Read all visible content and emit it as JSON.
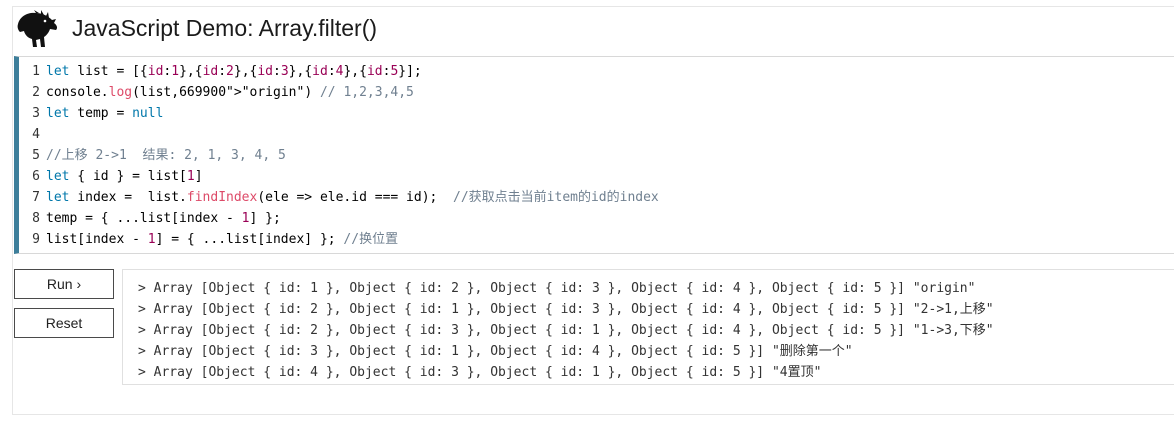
{
  "header": {
    "title": "JavaScript Demo: Array.filter()"
  },
  "editor": {
    "lines": [
      {
        "num": "1",
        "text": "let list = [{id:1},{id:2},{id:3},{id:4},{id:5}];"
      },
      {
        "num": "2",
        "text": "console.log(list,\"origin\") // 1,2,3,4,5"
      },
      {
        "num": "3",
        "text": "let temp = null"
      },
      {
        "num": "4",
        "text": ""
      },
      {
        "num": "5",
        "text": "//上移 2->1  结果: 2, 1, 3, 4, 5"
      },
      {
        "num": "6",
        "text": "let { id } = list[1]"
      },
      {
        "num": "7",
        "text": "let index =  list.findIndex(ele => ele.id === id);  //获取点击当前item的id的index"
      },
      {
        "num": "8",
        "text": "temp = { ...list[index - 1] };"
      },
      {
        "num": "9",
        "text": "list[index - 1] = { ...list[index] }; //换位置"
      }
    ]
  },
  "buttons": {
    "run_label": "Run ›",
    "reset_label": "Reset"
  },
  "console": {
    "lines": [
      "> Array [Object { id: 1 }, Object { id: 2 }, Object { id: 3 }, Object { id: 4 }, Object { id: 5 }] \"origin\"",
      "> Array [Object { id: 2 }, Object { id: 1 }, Object { id: 3 }, Object { id: 4 }, Object { id: 5 }] \"2->1,上移\"",
      "> Array [Object { id: 2 }, Object { id: 3 }, Object { id: 1 }, Object { id: 4 }, Object { id: 5 }] \"1->3,下移\"",
      "> Array [Object { id: 3 }, Object { id: 1 }, Object { id: 4 }, Object { id: 5 }] \"删除第一个\"",
      "> Array [Object { id: 4 }, Object { id: 3 }, Object { id: 1 }, Object { id: 5 }] \"4置顶\""
    ]
  },
  "colors": {
    "editor_accent": "#3d7e9a",
    "keyword": "#0077aa",
    "number": "#990055",
    "string": "#669900",
    "comment": "#708090"
  }
}
